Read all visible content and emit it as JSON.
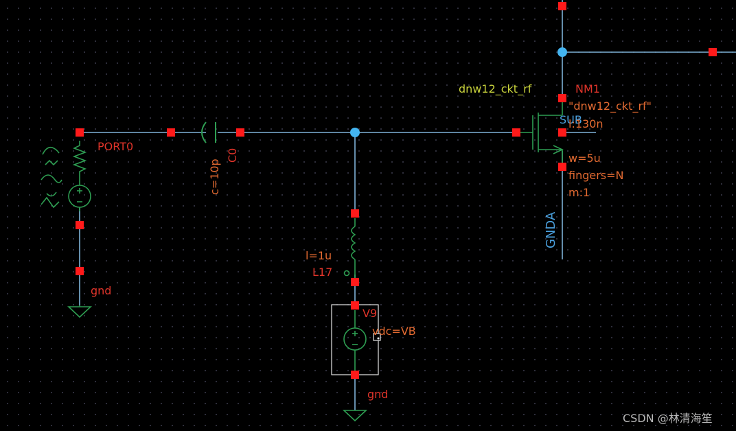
{
  "colors": {
    "background": "#000000",
    "wire": "#7fb3d8",
    "pin": "#ff1a1a",
    "junction": "#43b4f0",
    "symbol_green": "#2e9e52",
    "label_orange": "#e36a31",
    "label_red": "#e0342a",
    "label_yellow": "#c8d23c",
    "label_blue": "#4a9fdc",
    "watermark": "#b9b9b9"
  },
  "port": {
    "name": "PORT0",
    "gnd": "gnd"
  },
  "capacitor": {
    "value": "c=10p",
    "name": "C0"
  },
  "inductor": {
    "value": "l=1u",
    "name": "L17"
  },
  "vsource": {
    "name": "V9",
    "value": "vdc=VB",
    "gnd": "gnd"
  },
  "transistor": {
    "cell": "dnw12_ckt_rf",
    "name": "NM1",
    "model": "\"dnw12_ckt_rf\"",
    "sub": "SUB",
    "length": "l:130n",
    "width": "w=5u",
    "fingers": "fingers=N",
    "multiplier": "m:1",
    "bulk_net": "GNDA"
  },
  "watermark": "CSDN @林清海笙"
}
